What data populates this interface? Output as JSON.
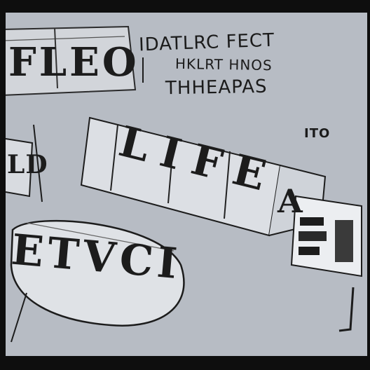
{
  "header": {
    "line1": "IDATLRC FECT",
    "line2": "HKLRT HNOS",
    "line3": "THHEAPAS"
  },
  "side_note": "ITO",
  "panels": {
    "top_left": "FLEO",
    "center": "LIFE",
    "center_tail": "A",
    "bottom_left": "ETVCI",
    "left_fragment": "LD"
  },
  "colors": {
    "background": "#b7bcc4",
    "ink": "#1c1c1c",
    "frame": "#0e0e0e",
    "panel": "#dcdfe4"
  }
}
